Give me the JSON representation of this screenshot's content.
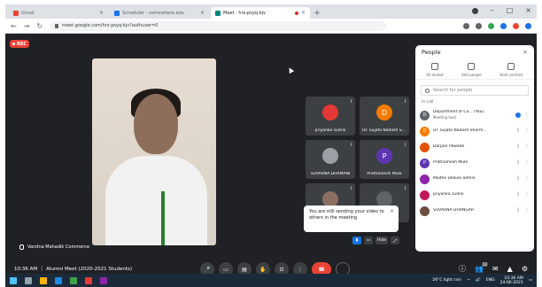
{
  "browser": {
    "tabs": [
      {
        "title": "Gmail",
        "active": false,
        "favicon_color": "#ea4335"
      },
      {
        "title": "Scheduler - somewhere.edu",
        "active": false,
        "favicon_color": "#1a73e8"
      },
      {
        "title": "Meet - hrs-psyq-kjv",
        "active": true,
        "favicon_color": "#00897b"
      }
    ],
    "url": "meet.google.com/hrs-psyq-kjv?authuser=0"
  },
  "meet": {
    "recording_label": "REC",
    "presenter_name": "Vandna Mahadik Commerce",
    "grid": [
      {
        "name": "priyanka sudrik",
        "initial": "",
        "color": "#e53935"
      },
      {
        "name": "Dr. Sujata Nadash Sharma",
        "initial": "D",
        "color": "#f57c00"
      },
      {
        "name": "SUVARNA DHAMANI",
        "initial": "",
        "color": "#5f6368"
      },
      {
        "name": "Prathamesh Mule",
        "initial": "P",
        "color": "#5e35b1"
      },
      {
        "name": "",
        "initial": "",
        "color": "#8d6e63"
      },
      {
        "name": "",
        "initial": "",
        "color": "#5f6368"
      }
    ],
    "toast_text": "You are still sending your video to others in the meeting",
    "self_controls": {
      "more_label": "Hide"
    },
    "time": "10:36 AM",
    "meeting_title": "Alumni Meet (2020-2021 Students)",
    "host_badge": "12"
  },
  "panel": {
    "title": "People",
    "actions": [
      "All muted",
      "Add people",
      "Host controls"
    ],
    "search_placeholder": "Search for people",
    "section": "In call",
    "people": [
      {
        "name": "Department of Co... (You)",
        "sub": "Meeting host",
        "color": "#5f6368",
        "initial": "D"
      },
      {
        "name": "Dr. Sujata Nadash Sharm...",
        "sub": "",
        "color": "#f57c00",
        "initial": "D"
      },
      {
        "name": "Darpan Pawade",
        "sub": "",
        "color": "#e65100",
        "initial": ""
      },
      {
        "name": "Prathamesh Mule",
        "sub": "",
        "color": "#5e35b1",
        "initial": "P"
      },
      {
        "name": "Madhe Dekule admin",
        "sub": "",
        "color": "#8e24aa",
        "initial": ""
      },
      {
        "name": "priyanka sudrik",
        "sub": "",
        "color": "#c2185b",
        "initial": ""
      },
      {
        "name": "SUVARNA DHANGAR",
        "sub": "",
        "color": "#6d4c41",
        "initial": ""
      }
    ]
  },
  "taskbar": {
    "weather": "26°C light rain",
    "lang": "ENG",
    "clock_time": "10:36 AM",
    "clock_date": "24-06-2021"
  }
}
